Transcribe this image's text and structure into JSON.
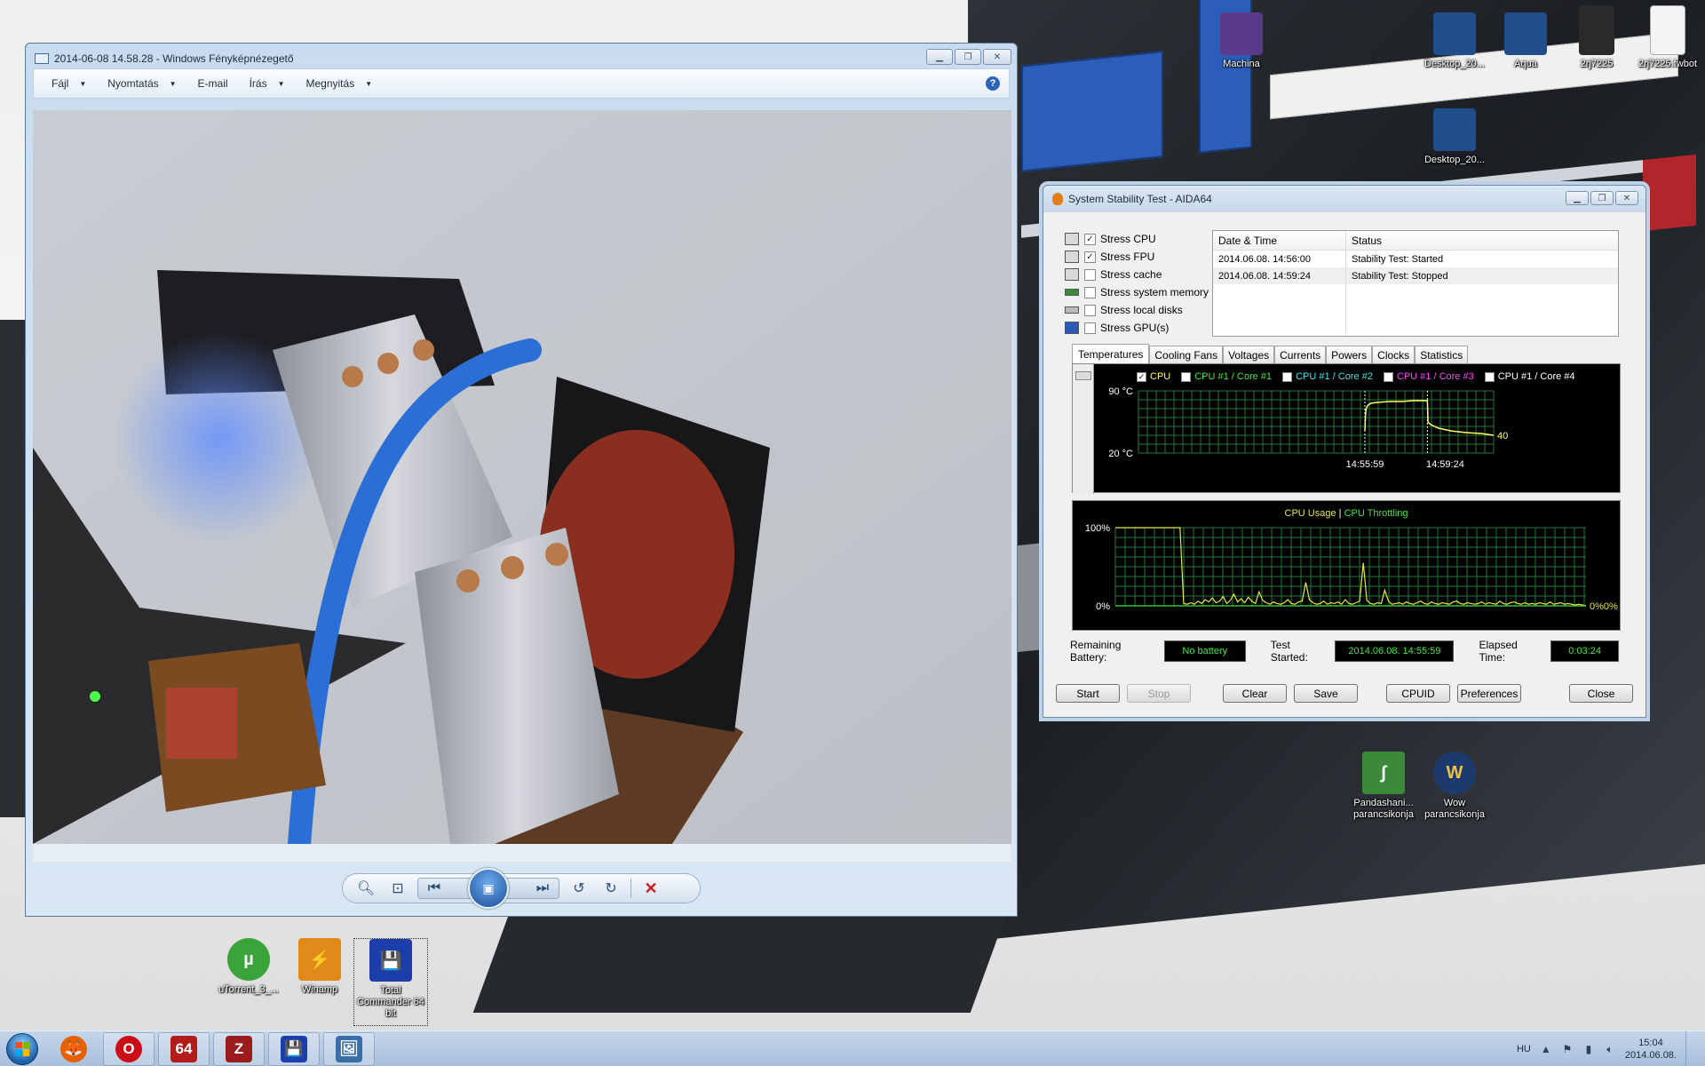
{
  "desktop": {
    "icons_right": [
      {
        "label": "Machina",
        "color": "#5a3a8a",
        "glyph": ""
      },
      {
        "label": "Desktop_20...",
        "color": "#1f4e8a",
        "glyph": ""
      },
      {
        "label": "Aqua",
        "color": "#1f4e8a",
        "glyph": ""
      },
      {
        "label": "2rj7225",
        "color": "#2a2a2a",
        "glyph": ""
      },
      {
        "label": "2rj7225.fwbot",
        "color": "#f4f4f4",
        "glyph": ""
      },
      {
        "label": "Desktop_20...",
        "color": "#1f4e8a",
        "glyph": ""
      }
    ],
    "icons_bottom": [
      {
        "label": "uTorrent_3_...",
        "color": "#3aa43a",
        "glyph": "µ"
      },
      {
        "label": "Winamp",
        "color": "#e08a1a",
        "glyph": "⚡"
      },
      {
        "label": "Total Commander 64 bit",
        "color": "#1c3ea8",
        "glyph": "💾"
      }
    ],
    "icons_mid": [
      {
        "label": "Pandashani... parancsikonja",
        "color": "#3a8a3a",
        "glyph": "∫"
      },
      {
        "label": "Wow parancsikonja",
        "color": "#1c3a6e",
        "glyph": "W"
      }
    ]
  },
  "photo_viewer": {
    "title": "2014-06-08 14.58.28 - Windows Fényképnézegető",
    "menu": [
      {
        "label": "Fájl",
        "dropdown": true
      },
      {
        "label": "Nyomtatás",
        "dropdown": true
      },
      {
        "label": "E-mail",
        "dropdown": false
      },
      {
        "label": "Írás",
        "dropdown": true
      },
      {
        "label": "Megnyitás",
        "dropdown": true
      }
    ],
    "help_glyph": "?",
    "toolbar": {
      "zoom_icon": "zoom-icon",
      "fit_icon": "actual-size-icon",
      "prev_icon": "previous-icon",
      "slideshow_icon": "slideshow-icon",
      "next_icon": "next-icon",
      "rotate_ccw_icon": "rotate-left-icon",
      "rotate_cw_icon": "rotate-right-icon",
      "delete_icon": "delete-icon"
    }
  },
  "aida": {
    "title": "System Stability Test - AIDA64",
    "stress_options": [
      {
        "label": "Stress CPU",
        "checked": true
      },
      {
        "label": "Stress FPU",
        "checked": true
      },
      {
        "label": "Stress cache",
        "checked": false
      },
      {
        "label": "Stress system memory",
        "checked": false
      },
      {
        "label": "Stress local disks",
        "checked": false
      },
      {
        "label": "Stress GPU(s)",
        "checked": false
      }
    ],
    "log": {
      "headers": [
        "Date & Time",
        "Status"
      ],
      "rows": [
        [
          "2014.06.08. 14:56:00",
          "Stability Test: Started"
        ],
        [
          "2014.06.08. 14:59:24",
          "Stability Test: Stopped"
        ]
      ]
    },
    "tabs": [
      "Temperatures",
      "Cooling Fans",
      "Voltages",
      "Currents",
      "Powers",
      "Clocks",
      "Statistics"
    ],
    "active_tab": "Temperatures",
    "temp_legend": [
      {
        "label": "CPU",
        "color": "#ffff66",
        "checked": true
      },
      {
        "label": "CPU #1 / Core #1",
        "color": "#3fe83f",
        "checked": false
      },
      {
        "label": "CPU #1 / Core #2",
        "color": "#3fe8e8",
        "checked": false
      },
      {
        "label": "CPU #1 / Core #3",
        "color": "#ff44ff",
        "checked": false
      },
      {
        "label": "CPU #1 / Core #4",
        "color": "#ffffff",
        "checked": false
      }
    ],
    "usage_title_a": "CPU Usage",
    "usage_sep": "|",
    "usage_title_b": "CPU Throttling",
    "bottom": {
      "battery_label": "Remaining Battery:",
      "battery_value": "No battery",
      "started_label": "Test Started:",
      "started_value": "2014.06.08. 14:55:59",
      "elapsed_label": "Elapsed Time:",
      "elapsed_value": "0:03:24"
    },
    "buttons": {
      "start": "Start",
      "stop": "Stop",
      "clear": "Clear",
      "save": "Save",
      "cpuid": "CPUID",
      "preferences": "Preferences",
      "close": "Close"
    }
  },
  "chart_data": [
    {
      "type": "line",
      "title": "",
      "ylabel": "",
      "y_ticks": [
        "90 °C",
        "20 °C"
      ],
      "ylim": [
        20,
        90
      ],
      "x_ticks": [
        "14:55:59",
        "14:59:24"
      ],
      "series": [
        {
          "name": "CPU",
          "color": "#ffff66",
          "t": [
            0,
            2,
            4,
            10,
            20,
            40,
            80,
            120,
            160,
            190,
            204,
            206,
            215,
            240,
            280,
            330,
            380,
            420
          ],
          "values": [
            45,
            63,
            70,
            74,
            76,
            77,
            78,
            78,
            79,
            79,
            79,
            55,
            52,
            48,
            45,
            43,
            42,
            40
          ]
        }
      ],
      "end_label": "40",
      "grid": true
    },
    {
      "type": "line",
      "title": "CPU Usage | CPU Throttling",
      "y_ticks": [
        "100%",
        "0%"
      ],
      "ylim": [
        0,
        100
      ],
      "series": [
        {
          "name": "CPU Usage",
          "color": "#3fe83f",
          "values": [
            100,
            100,
            100,
            100,
            100,
            100,
            100,
            100,
            100,
            100,
            100,
            100,
            100,
            100,
            100,
            100,
            100,
            100,
            100,
            3,
            2,
            4,
            2,
            6,
            3,
            8,
            5,
            10,
            4,
            6,
            12,
            3,
            7,
            15,
            5,
            9,
            4,
            11,
            6,
            3,
            18,
            7,
            4,
            2,
            5,
            3,
            2,
            4,
            8,
            3,
            2,
            5,
            6,
            30,
            8,
            4,
            2,
            3,
            6,
            2,
            4,
            3,
            5,
            2,
            8,
            3,
            2,
            4,
            6,
            55,
            7,
            3,
            2,
            4,
            3,
            20,
            6,
            2,
            3,
            4,
            2,
            5,
            3,
            2,
            4,
            6,
            3,
            2,
            5,
            3,
            2,
            4,
            3,
            2,
            5,
            6,
            3,
            2,
            4,
            3,
            2,
            3,
            5,
            2,
            4,
            3,
            2,
            6,
            3,
            2,
            4,
            5,
            3,
            2,
            4,
            2,
            3,
            2,
            4,
            3,
            2,
            5,
            2,
            3,
            4,
            2,
            3,
            2,
            1,
            2,
            1,
            0
          ]
        },
        {
          "name": "CPU Throttling",
          "color": "#a4c639",
          "values": []
        }
      ],
      "end_label": "0%0%",
      "grid": true
    }
  ],
  "taskbar": {
    "items": [
      {
        "name": "firefox",
        "color": "#e66000",
        "glyph": "🦊"
      },
      {
        "name": "opera",
        "color": "#cc0f16",
        "glyph": "O"
      },
      {
        "name": "aida64",
        "color": "#b41c1c",
        "glyph": "64"
      },
      {
        "name": "cpu-z",
        "color": "#9b1c1c",
        "glyph": "Z"
      },
      {
        "name": "total-commander",
        "color": "#1c3ea8",
        "glyph": "💾"
      },
      {
        "name": "photo-viewer",
        "color": "#3b6ea8",
        "glyph": "🖼"
      }
    ],
    "language": "HU",
    "time": "15:04",
    "date": "2014.06.08."
  }
}
